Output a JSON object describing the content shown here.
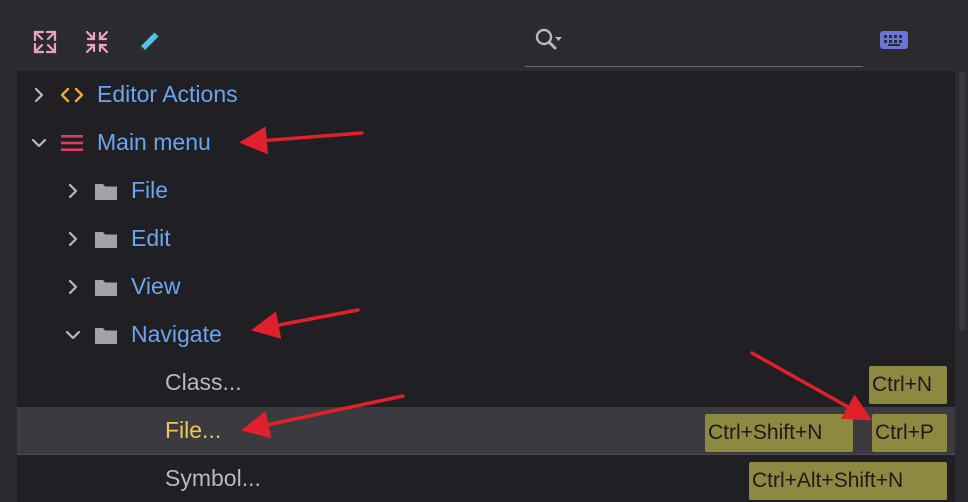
{
  "toolbar": {
    "buttons": [
      {
        "name": "expand-all-icon"
      },
      {
        "name": "collapse-all-icon"
      },
      {
        "name": "edit-icon"
      }
    ],
    "search": {
      "placeholder": "",
      "value": "",
      "icon": "search-icon"
    },
    "keyboard_icon": "keyboard-icon"
  },
  "tree": {
    "items": [
      {
        "label": "Editor Actions",
        "expanded": false,
        "icon": "code-brackets-icon"
      },
      {
        "label": "Main menu",
        "expanded": true,
        "icon": "menu-lines-icon"
      },
      {
        "label": "File",
        "expanded": false,
        "icon": "folder-icon"
      },
      {
        "label": "Edit",
        "expanded": false,
        "icon": "folder-icon"
      },
      {
        "label": "View",
        "expanded": false,
        "icon": "folder-icon"
      },
      {
        "label": "Navigate",
        "expanded": true,
        "icon": "folder-icon"
      },
      {
        "label": "Class...",
        "shortcuts": [
          "Ctrl+N"
        ]
      },
      {
        "label": "File...",
        "shortcuts": [
          "Ctrl+Shift+N",
          "Ctrl+P"
        ],
        "selected": true
      },
      {
        "label": "Symbol...",
        "shortcuts": [
          "Ctrl+Alt+Shift+N"
        ]
      }
    ]
  },
  "colors": {
    "background": "#2b2a2e",
    "tree_background": "#201f23",
    "selection": "#3b3a3f",
    "link_blue": "#6aa5ee",
    "selected_text": "#f1c75a",
    "shortcut_bg": "#8e8940",
    "annotation_arrow": "#e0202a"
  }
}
